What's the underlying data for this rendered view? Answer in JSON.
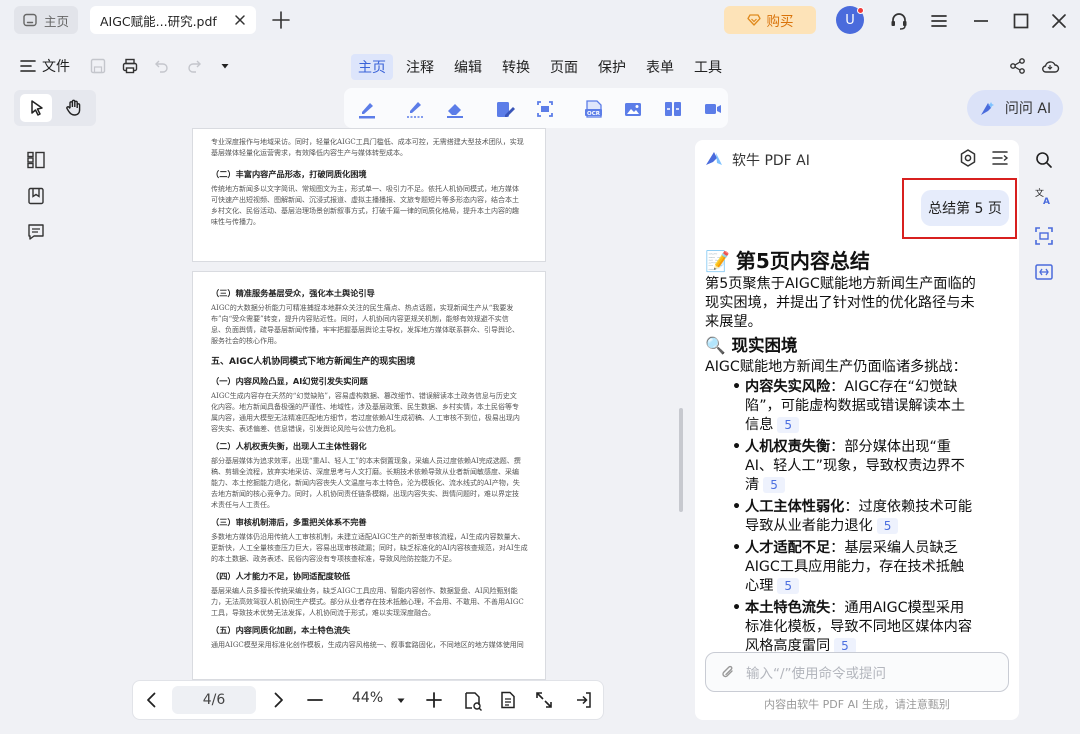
{
  "tabs": {
    "home_label": "主页",
    "doc_label": "AIGC赋能...研究.pdf"
  },
  "titlebar": {
    "buy_label": "购买",
    "avatar_initial": "U"
  },
  "menu": {
    "file_label": "文件",
    "items": [
      "主页",
      "注释",
      "编辑",
      "转换",
      "页面",
      "保护",
      "表单",
      "工具"
    ],
    "active": "主页"
  },
  "toolbar": {
    "ask_ai_label": "问问 AI"
  },
  "document": {
    "page1": {
      "lines_top": [
        "专业深度报作与地域采访。同时，轻量化AIGC工具门槛低、成本可控，无需搭建大型技术团队，实现",
        "基层媒体轻量化运营需求，有效降低内容生产与媒体转型成本。"
      ],
      "heading": "（二）丰富内容产品形态，打破同质化困境",
      "paragraph": [
        "传统地方新闻多以文字简讯、常规图文为主，形式单一、吸引力不足。依托人机协同模式，地方媒体",
        "可快速产出短视频、图解新闻、沉浸式报道、虚拟主播播报、文旅专题短片等多形态内容，结合本土",
        "乡村文化、民俗活动、基层治理场景创新叙事方式，打破千篇一律的同质化格局，提升本土内容的趣",
        "味性与传播力。"
      ]
    },
    "page2": {
      "sections": [
        {
          "heading": "（三）精准服务基层受众，强化本土舆论引导",
          "lines": [
            "AIGC的大数据分析能力可精准捕捉本地群众关注的民生痛点、热点话题，实现新闻生产从“我要发",
            "布”向“受众需要”转变，提升内容贴近性。同时，人机协同内容更规关机制，能够有效规避不实信",
            "息、负面舆情，疏导基层新闻传播，牢牢把握基层舆论主导权，发挥地方媒体联系群众、引导舆论、",
            "服务社会的核心作用。"
          ]
        },
        {
          "heading": "五、AIGC人机协同模式下地方新闻生产的现实困境",
          "lines": []
        },
        {
          "heading": "（一）内容风险凸显，AI幻觉引发失实问题",
          "lines": [
            "AIGC生成内容存在天然的“幻觉缺陷”，容易虚构数据、篡改细节、错误解读本土政务信息与历史文",
            "化内容。地方新闻具备极强的严谨性、地域性，涉及基层政策、民生数据、乡村实情，本土民俗等专",
            "属内容，通用大模型无法精准匹配地方细节，若过度依赖AI生成初稿、人工审核不到位，极易出现内",
            "容失实、表述偏差、信息错误，引发舆论风险与公信力危机。"
          ]
        },
        {
          "heading": "（二）人机权责失衡，出现人工主体性弱化",
          "lines": [
            "部分基层媒体为追求效率，出现“重AI、轻人工”的本末倒置现象，采编人员过度依赖AI完成选题、撰",
            "稿、剪辑全流程，放弃实地采访、深度思考与人文打磨。长期技术依赖导致从业者新闻敏感度、采编",
            "能力、本土挖掘能力退化，新闻内容丧失人文温度与本土特色，沦为模板化、流水线式的AI产物，失",
            "去地方新闻的核心竞争力。同时，人机协同责任链条模糊，出现内容失实、舆情问题时，难以界定技",
            "术责任与人工责任。"
          ]
        },
        {
          "heading": "（三）审核机制滞后，多重把关体系不完善",
          "lines": [
            "多数地方媒体仍沿用传统人工审核机制，未建立适配AIGC生产的新型审核流程，AI生成内容数量大、",
            "更新快，人工全量核查压力巨大，容易出现审核疏漏；同时，缺乏标准化的AI内容核查规范，对AI生成",
            "的本土数据、政务表述、民俗内容没有专项核查标准，导致风险防控能力不足。"
          ]
        },
        {
          "heading": "（四）人才能力不足，协同适配度较低",
          "lines": [
            "基层采编人员多擅长传统采编业务，缺乏AIGC工具应用、智能内容创作、数据复盘、AI风险甄别能",
            "力，无法高效驾驭人机协同生产模式。部分从业者存在技术抵触心理，不会用、不敢用、不善用AIGC",
            "工具，导致技术优势无法发挥，人机协同流于形式，难以实现深度融合。"
          ]
        },
        {
          "heading": "（五）内容同质化加剧，本土特色流失",
          "lines": [
            "通用AIGC模型采用标准化创作模板，生成内容风格统一、叙事套路固化，不同地区的地方媒体使用同"
          ]
        }
      ]
    }
  },
  "bottombar": {
    "page_indicator": "4/6",
    "zoom": "44%"
  },
  "ai_panel": {
    "title": "软牛 PDF AI",
    "user_message": "总结第 5 页",
    "summary_heading": "第5页内容总结",
    "summary_heading_emoji": "📝",
    "summary_text": "第5页聚焦于AIGC赋能地方新闻生产面临的现实困境，并提出了针对性的优化路径与未来展望。",
    "section_heading": "现实困境",
    "section_heading_emoji": "🔍",
    "section_intro": "AIGC赋能地方新闻生产仍面临诸多挑战：",
    "items": [
      {
        "bold": "内容失实风险",
        "text": "：AIGC存在“幻觉缺陷”，可能虚构数据或错误解读本土信息",
        "ref": "5"
      },
      {
        "bold": "人机权责失衡",
        "text": "：部分媒体出现“重AI、轻人工”现象，导致权责边界不清",
        "ref": "5"
      },
      {
        "bold": "人工主体性弱化",
        "text": "：过度依赖技术可能导致从业者能力退化",
        "ref": "5"
      },
      {
        "bold": "人才适配不足",
        "text": "：基层采编人员缺乏AIGC工具应用能力，存在技术抵触心理",
        "ref": "5"
      },
      {
        "bold": "本土特色流失",
        "text": "：通用AIGC模型采用标准化模板，导致不同地区媒体内容风格高度雷同",
        "ref": "5"
      }
    ],
    "input_placeholder": "输入“/”使用命令或提问",
    "footer": "内容由软牛 PDF AI 生成，请注意甄别"
  },
  "colors": {
    "accent": "#3a63d8",
    "buy_bg": "#fde3b8",
    "buy_text": "#d9730a",
    "highlight_border": "#d8201f"
  }
}
